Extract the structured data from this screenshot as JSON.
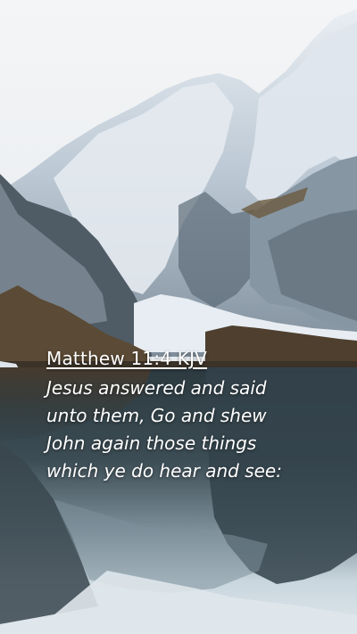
{
  "verse": {
    "reference": "Matthew 11:4 KJV",
    "lines": [
      "Jesus answered and said",
      "unto them, Go and shew",
      "John again those things",
      "which ye do hear and see:"
    ]
  },
  "colors": {
    "sky": "#eef1f3",
    "snow": "#e3e9ee",
    "rock": "#8a9aa8",
    "forest": "#5a4a36",
    "water": "#2e3b40",
    "text": "#ffffff"
  }
}
